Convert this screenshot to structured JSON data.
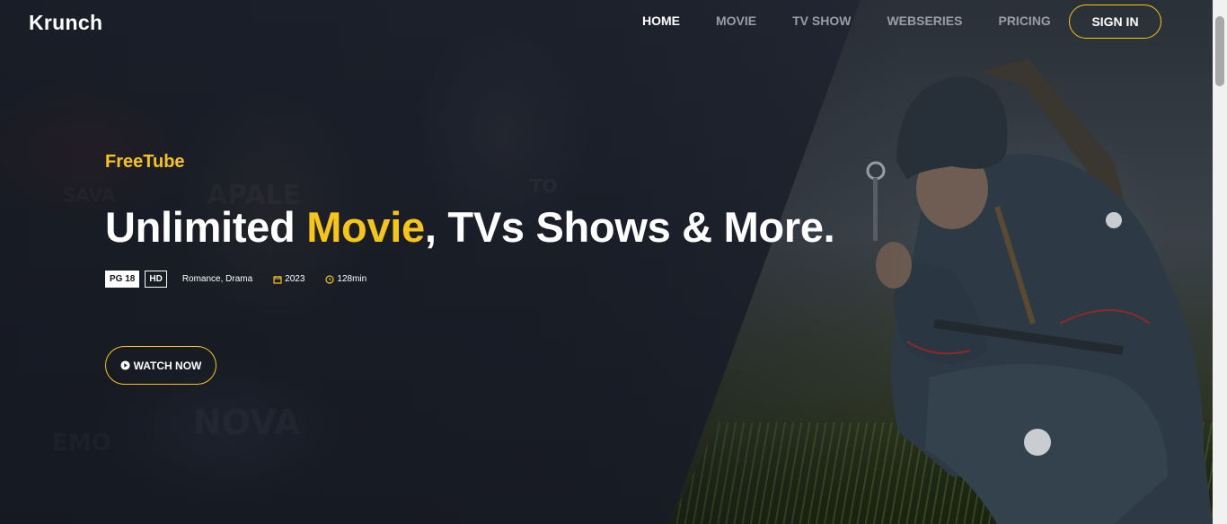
{
  "header": {
    "logo": "Krunch",
    "nav": [
      {
        "label": "HOME",
        "active": true
      },
      {
        "label": "MOVIE",
        "active": false
      },
      {
        "label": "TV SHOW",
        "active": false
      },
      {
        "label": "WEBSERIES",
        "active": false
      },
      {
        "label": "PRICING",
        "active": false
      }
    ],
    "sign_in_label": "SIGN IN"
  },
  "hero": {
    "tagline": "FreeTube",
    "headline_part1": "Unlimited ",
    "headline_highlight": "Movie",
    "headline_part2": ", TVs Shows & More.",
    "rating_badge": "PG 18",
    "quality_badge": "HD",
    "genre": "Romance, Drama",
    "year": "2023",
    "duration": "128min",
    "watch_label": "WATCH NOW"
  },
  "colors": {
    "accent": "#f5c518",
    "background": "#1b1f28",
    "nav_inactive": "#9a9da6"
  },
  "icons": {
    "year": "calendar-icon",
    "duration": "clock-icon",
    "watch": "play-circle-icon"
  }
}
